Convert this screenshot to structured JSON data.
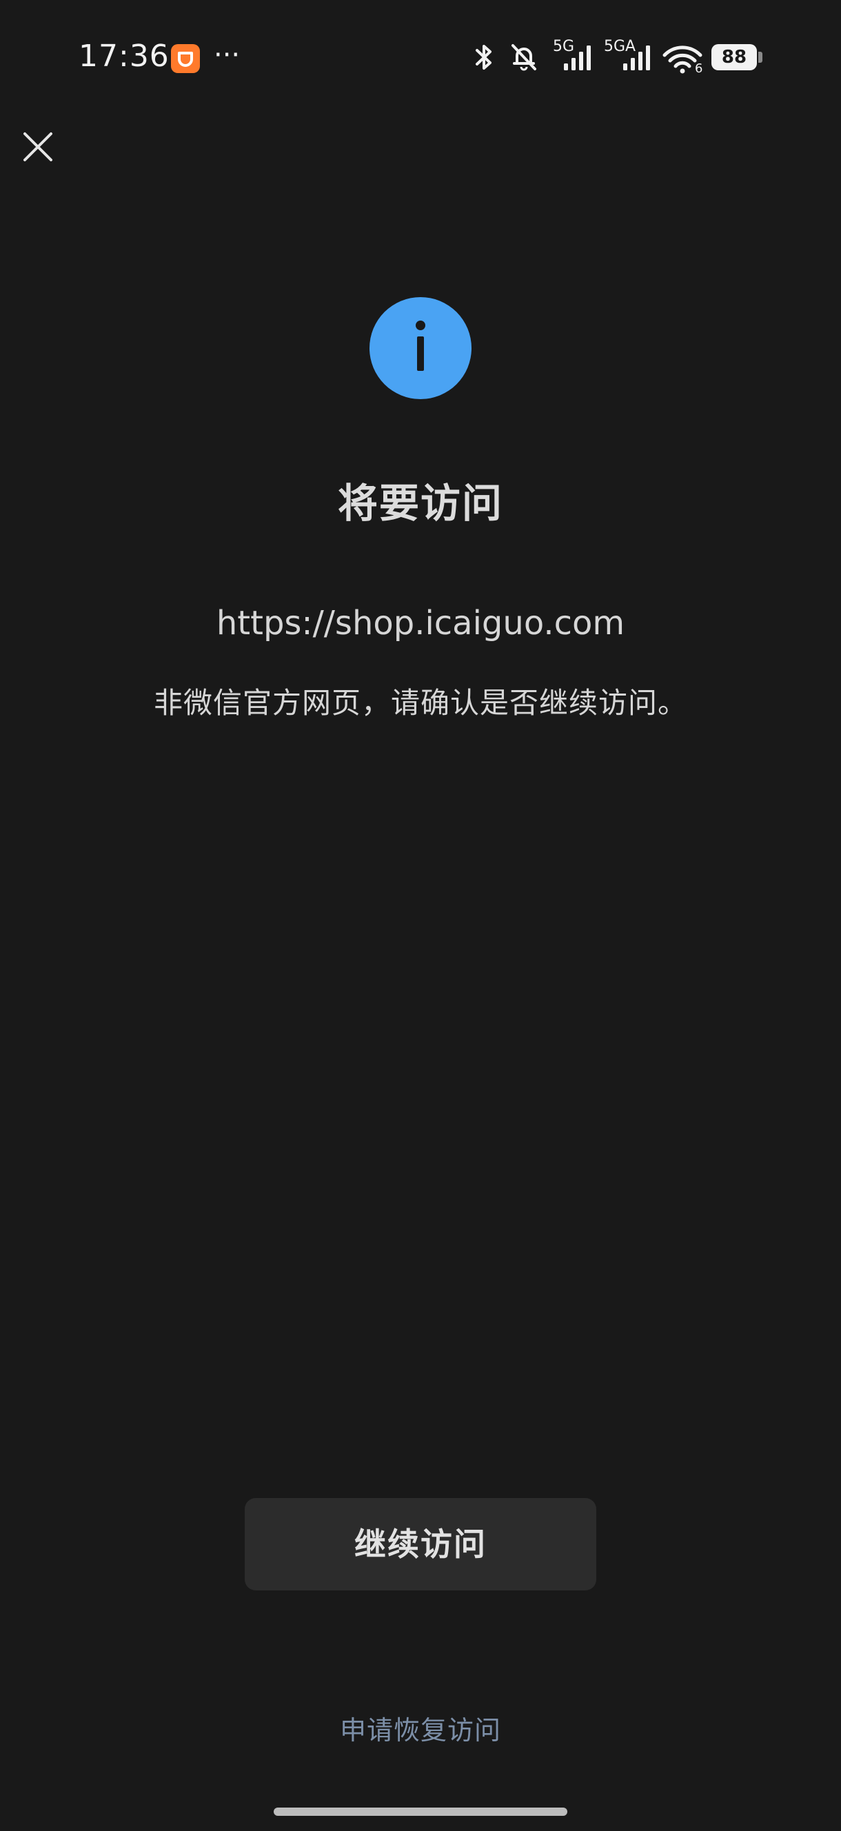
{
  "status_bar": {
    "time": "17:36",
    "more": "···",
    "net1_label": "5G",
    "net2_label": "5GA",
    "wifi_label": "6",
    "battery": "88"
  },
  "dialog": {
    "title": "将要访问",
    "url": "https://shop.icaiguo.com",
    "warning": "非微信官方网页，请确认是否继续访问。"
  },
  "actions": {
    "continue_label": "继续访问",
    "restore_label": "申请恢复访问"
  },
  "colors": {
    "background": "#191919",
    "info_blue": "#4aa3f3",
    "button_bg": "#2c2c2c",
    "link": "#7c8fa8",
    "app_badge": "#ff7a2b"
  },
  "icons": {
    "close": "close-icon",
    "info": "info-icon",
    "bluetooth": "bluetooth-icon",
    "mute": "bell-muted-icon",
    "signal": "cellular-signal-icon",
    "wifi": "wifi-icon"
  }
}
